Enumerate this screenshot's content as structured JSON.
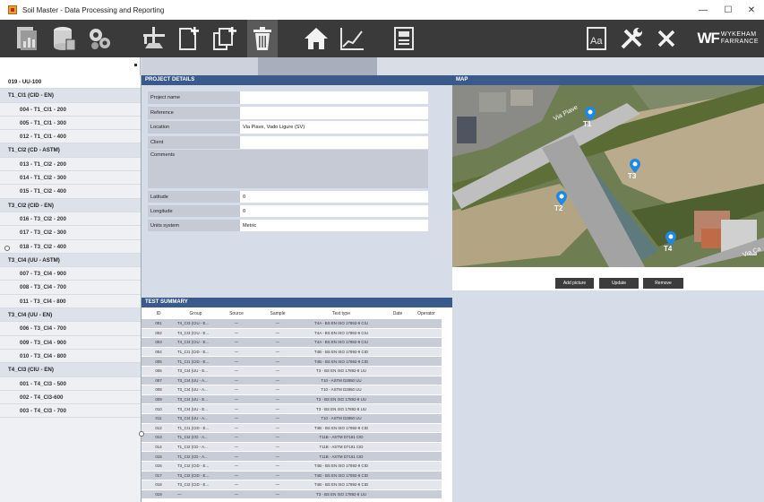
{
  "window": {
    "title": "Soil Master - Data Processing and Reporting",
    "controls": {
      "minimize": "—",
      "maximize": "☐",
      "close": "✕"
    }
  },
  "toolbar": {
    "brand": {
      "logo": "WF",
      "line1": "WYKEHAM",
      "line2": "FARRANCE"
    },
    "icons": [
      "report-icon",
      "database-icon",
      "settings-gears-icon",
      "drill-rig-icon",
      "new-document-icon",
      "duplicate-document-icon",
      "trash-icon",
      "home-icon",
      "chart-icon",
      "document-view-icon",
      "font-settings-icon",
      "tools-icon",
      "close-x-icon"
    ]
  },
  "project_selector": {
    "value": ""
  },
  "sidebar": {
    "root": "019 - UU-100",
    "groups": [
      {
        "label": "T1_CI1 (CID - EN)",
        "items": [
          "004 - T1_CI1 - 200",
          "005 - T1_CI1 - 300",
          "012 - T1_CI1 - 400"
        ]
      },
      {
        "label": "T1_CI2 (CD - ASTM)",
        "items": [
          "013 - T1_CI2 - 200",
          "014 - T1_CI2 - 300",
          "015 - T1_CI2 - 400"
        ]
      },
      {
        "label": "T3_CI2 (CID - EN)",
        "items": [
          "016 - T3_CI2 - 200",
          "017 - T3_CI2 - 300",
          "018 - T3_CI2 - 400"
        ]
      },
      {
        "label": "T3_CI4 (UU - ASTM)",
        "items": [
          "007 - T3_CI4 - 900",
          "008 - T3_CI4 - 700",
          "011 - T3_CI4 - 800"
        ]
      },
      {
        "label": "T3_CI4 (UU - EN)",
        "items": [
          "006 - T3_CI4 - 700",
          "009 - T3_CI4 - 900",
          "010 - T3_CI4 - 800"
        ]
      },
      {
        "label": "T4_CI3 (CIU - EN)",
        "items": [
          "001 - T4_CI3 - 500",
          "002 - T4_CI3-600",
          "003 - T4_CI3 - 700"
        ]
      }
    ]
  },
  "project_details": {
    "header": "PROJECT DETAILS",
    "fields": [
      {
        "label": "Project name",
        "value": ""
      },
      {
        "label": "Reference",
        "value": ""
      },
      {
        "label": "Location",
        "value": "Via Piave, Vado Ligure (SV)"
      },
      {
        "label": "Client",
        "value": ""
      },
      {
        "label": "Comments",
        "value": ""
      },
      {
        "label": "Latitude",
        "value": "0"
      },
      {
        "label": "Longitude",
        "value": "0"
      },
      {
        "label": "Units system",
        "value": "Metric"
      }
    ]
  },
  "map": {
    "header": "MAP",
    "road_label": "Via Piave",
    "road_label_2": "Via Ca",
    "markers": [
      {
        "label": "T1"
      },
      {
        "label": "T2"
      },
      {
        "label": "T3"
      },
      {
        "label": "T4"
      }
    ],
    "buttons": {
      "add": "Add picture",
      "update": "Update",
      "remove": "Remove"
    },
    "colors": {
      "pin": "#1e88e5"
    }
  },
  "test_summary": {
    "header": "TEST SUMMARY",
    "columns": [
      "ID",
      "Group",
      "Source",
      "Sample",
      "Test type",
      "Date",
      "Operator"
    ],
    "rows": [
      [
        "001",
        "T4_CI3 (CIU - E...",
        "—",
        "—",
        "T4A - BS EN ISO 17892-9 CIU",
        "",
        ""
      ],
      [
        "002",
        "T4_CI3 (CIU - E...",
        "—",
        "—",
        "T4A - BS EN ISO 17892-9 CIU",
        "",
        ""
      ],
      [
        "003",
        "T4_CI3 (CIU - E...",
        "—",
        "—",
        "T4A - BS EN ISO 17892-9 CIU",
        "",
        ""
      ],
      [
        "004",
        "T1_CI1 (CID - E...",
        "—",
        "—",
        "T4B - BS EN ISO 17892-9 CID",
        "",
        ""
      ],
      [
        "005",
        "T1_CI1 (CID - E...",
        "—",
        "—",
        "T4B - BS EN ISO 17892-9 CID",
        "",
        ""
      ],
      [
        "006",
        "T3_CI4 (UU - E...",
        "—",
        "—",
        "T3 - BS EN ISO 17892-8 UU",
        "",
        ""
      ],
      [
        "007",
        "T3_CI4 (UU - A...",
        "—",
        "—",
        "T10 - ASTM D2850 UU",
        "",
        ""
      ],
      [
        "008",
        "T3_CI4 (UU - A...",
        "—",
        "—",
        "T10 - ASTM D2850 UU",
        "",
        ""
      ],
      [
        "009",
        "T3_CI4 (UU - E...",
        "—",
        "—",
        "T3 - BS EN ISO 17892-8 UU",
        "",
        ""
      ],
      [
        "010",
        "T3_CI4 (UU - E...",
        "—",
        "—",
        "T3 - BS EN ISO 17892-8 UU",
        "",
        ""
      ],
      [
        "011",
        "T3_CI4 (UU - A...",
        "—",
        "—",
        "T10 - ASTM D2850 UU",
        "",
        ""
      ],
      [
        "012",
        "T1_CI1 (CID - E...",
        "—",
        "—",
        "T4B - BS EN ISO 17892-9 CID",
        "",
        ""
      ],
      [
        "013",
        "T1_CI2 (CD - A...",
        "—",
        "—",
        "T11B - ASTM D7181 CID",
        "",
        ""
      ],
      [
        "014",
        "T1_CI2 (CD - A...",
        "—",
        "—",
        "T11B - ASTM D7181 CID",
        "",
        ""
      ],
      [
        "015",
        "T1_CI2 (CD - A...",
        "—",
        "—",
        "T11B - ASTM D7181 CID",
        "",
        ""
      ],
      [
        "016",
        "T3_CI2 (CID - E...",
        "—",
        "—",
        "T4B - BS EN ISO 17892-9 CID",
        "",
        ""
      ],
      [
        "017",
        "T3_CI2 (CID - E...",
        "—",
        "—",
        "T4B - BS EN ISO 17892-9 CID",
        "",
        ""
      ],
      [
        "018",
        "T3_CI2 (CID - E...",
        "—",
        "—",
        "T4B - BS EN ISO 17892-9 CID",
        "",
        ""
      ],
      [
        "019",
        "—",
        "—",
        "—",
        "T3 - BS EN ISO 17892-8 UU",
        "",
        ""
      ]
    ]
  }
}
